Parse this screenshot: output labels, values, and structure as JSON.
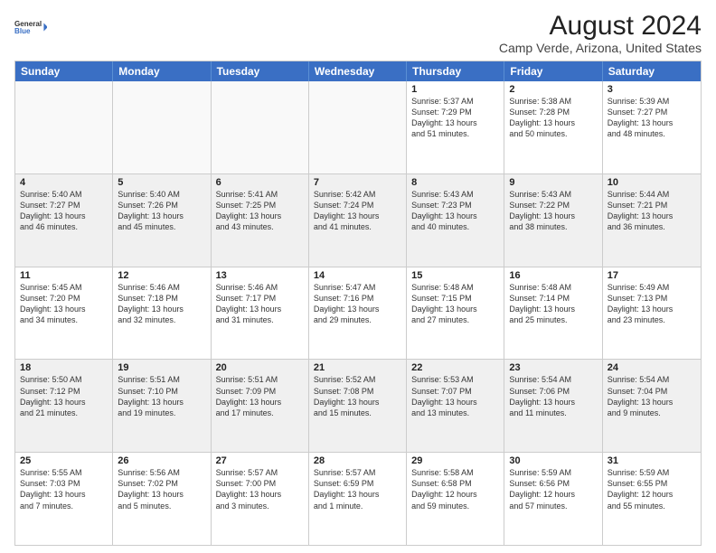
{
  "logo": {
    "general": "General",
    "blue": "Blue"
  },
  "title": "August 2024",
  "subtitle": "Camp Verde, Arizona, United States",
  "days": [
    "Sunday",
    "Monday",
    "Tuesday",
    "Wednesday",
    "Thursday",
    "Friday",
    "Saturday"
  ],
  "weeks": [
    [
      {
        "day": "",
        "info": "",
        "empty": true
      },
      {
        "day": "",
        "info": "",
        "empty": true
      },
      {
        "day": "",
        "info": "",
        "empty": true
      },
      {
        "day": "",
        "info": "",
        "empty": true
      },
      {
        "day": "1",
        "info": "Sunrise: 5:37 AM\nSunset: 7:29 PM\nDaylight: 13 hours\nand 51 minutes."
      },
      {
        "day": "2",
        "info": "Sunrise: 5:38 AM\nSunset: 7:28 PM\nDaylight: 13 hours\nand 50 minutes."
      },
      {
        "day": "3",
        "info": "Sunrise: 5:39 AM\nSunset: 7:27 PM\nDaylight: 13 hours\nand 48 minutes."
      }
    ],
    [
      {
        "day": "4",
        "info": "Sunrise: 5:40 AM\nSunset: 7:27 PM\nDaylight: 13 hours\nand 46 minutes."
      },
      {
        "day": "5",
        "info": "Sunrise: 5:40 AM\nSunset: 7:26 PM\nDaylight: 13 hours\nand 45 minutes."
      },
      {
        "day": "6",
        "info": "Sunrise: 5:41 AM\nSunset: 7:25 PM\nDaylight: 13 hours\nand 43 minutes."
      },
      {
        "day": "7",
        "info": "Sunrise: 5:42 AM\nSunset: 7:24 PM\nDaylight: 13 hours\nand 41 minutes."
      },
      {
        "day": "8",
        "info": "Sunrise: 5:43 AM\nSunset: 7:23 PM\nDaylight: 13 hours\nand 40 minutes."
      },
      {
        "day": "9",
        "info": "Sunrise: 5:43 AM\nSunset: 7:22 PM\nDaylight: 13 hours\nand 38 minutes."
      },
      {
        "day": "10",
        "info": "Sunrise: 5:44 AM\nSunset: 7:21 PM\nDaylight: 13 hours\nand 36 minutes."
      }
    ],
    [
      {
        "day": "11",
        "info": "Sunrise: 5:45 AM\nSunset: 7:20 PM\nDaylight: 13 hours\nand 34 minutes."
      },
      {
        "day": "12",
        "info": "Sunrise: 5:46 AM\nSunset: 7:18 PM\nDaylight: 13 hours\nand 32 minutes."
      },
      {
        "day": "13",
        "info": "Sunrise: 5:46 AM\nSunset: 7:17 PM\nDaylight: 13 hours\nand 31 minutes."
      },
      {
        "day": "14",
        "info": "Sunrise: 5:47 AM\nSunset: 7:16 PM\nDaylight: 13 hours\nand 29 minutes."
      },
      {
        "day": "15",
        "info": "Sunrise: 5:48 AM\nSunset: 7:15 PM\nDaylight: 13 hours\nand 27 minutes."
      },
      {
        "day": "16",
        "info": "Sunrise: 5:48 AM\nSunset: 7:14 PM\nDaylight: 13 hours\nand 25 minutes."
      },
      {
        "day": "17",
        "info": "Sunrise: 5:49 AM\nSunset: 7:13 PM\nDaylight: 13 hours\nand 23 minutes."
      }
    ],
    [
      {
        "day": "18",
        "info": "Sunrise: 5:50 AM\nSunset: 7:12 PM\nDaylight: 13 hours\nand 21 minutes."
      },
      {
        "day": "19",
        "info": "Sunrise: 5:51 AM\nSunset: 7:10 PM\nDaylight: 13 hours\nand 19 minutes."
      },
      {
        "day": "20",
        "info": "Sunrise: 5:51 AM\nSunset: 7:09 PM\nDaylight: 13 hours\nand 17 minutes."
      },
      {
        "day": "21",
        "info": "Sunrise: 5:52 AM\nSunset: 7:08 PM\nDaylight: 13 hours\nand 15 minutes."
      },
      {
        "day": "22",
        "info": "Sunrise: 5:53 AM\nSunset: 7:07 PM\nDaylight: 13 hours\nand 13 minutes."
      },
      {
        "day": "23",
        "info": "Sunrise: 5:54 AM\nSunset: 7:06 PM\nDaylight: 13 hours\nand 11 minutes."
      },
      {
        "day": "24",
        "info": "Sunrise: 5:54 AM\nSunset: 7:04 PM\nDaylight: 13 hours\nand 9 minutes."
      }
    ],
    [
      {
        "day": "25",
        "info": "Sunrise: 5:55 AM\nSunset: 7:03 PM\nDaylight: 13 hours\nand 7 minutes."
      },
      {
        "day": "26",
        "info": "Sunrise: 5:56 AM\nSunset: 7:02 PM\nDaylight: 13 hours\nand 5 minutes."
      },
      {
        "day": "27",
        "info": "Sunrise: 5:57 AM\nSunset: 7:00 PM\nDaylight: 13 hours\nand 3 minutes."
      },
      {
        "day": "28",
        "info": "Sunrise: 5:57 AM\nSunset: 6:59 PM\nDaylight: 13 hours\nand 1 minute."
      },
      {
        "day": "29",
        "info": "Sunrise: 5:58 AM\nSunset: 6:58 PM\nDaylight: 12 hours\nand 59 minutes."
      },
      {
        "day": "30",
        "info": "Sunrise: 5:59 AM\nSunset: 6:56 PM\nDaylight: 12 hours\nand 57 minutes."
      },
      {
        "day": "31",
        "info": "Sunrise: 5:59 AM\nSunset: 6:55 PM\nDaylight: 12 hours\nand 55 minutes."
      }
    ]
  ]
}
